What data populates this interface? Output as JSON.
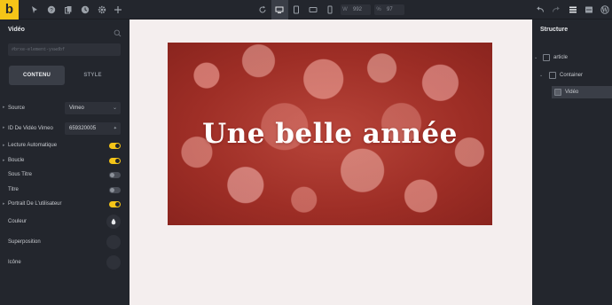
{
  "app": {
    "logo": "b",
    "accent": "#f5c518"
  },
  "topbar": {
    "width_label": "W",
    "width_value": "992",
    "zoom_label": "%",
    "zoom_value": "97"
  },
  "left_panel": {
    "title": "Vidéo",
    "element_id": "#brxe-element-yswdbf",
    "tabs": [
      "CONTENU",
      "STYLE"
    ],
    "fields": {
      "source": {
        "label": "Source",
        "value": "Vimeo"
      },
      "video_id": {
        "label": "ID De Vidéo Vimeo",
        "value": "659320005"
      },
      "autoplay": {
        "label": "Lecture Automatique",
        "on": true
      },
      "loop": {
        "label": "Boucle",
        "on": true
      },
      "subtitles": {
        "label": "Sous Titre",
        "on": false
      },
      "title": {
        "label": "Titre",
        "on": false
      },
      "portrait": {
        "label": "Portrait De L'utilisateur",
        "on": true
      },
      "color": {
        "label": "Couleur"
      },
      "overlay": {
        "label": "Superposition"
      },
      "icon": {
        "label": "Icône"
      }
    }
  },
  "canvas": {
    "video_text": "Une belle année",
    "background": "#f4eeee"
  },
  "structure": {
    "title": "Structure",
    "nodes": [
      {
        "label": "article"
      },
      {
        "label": "Container"
      },
      {
        "label": "Vidéo"
      }
    ]
  }
}
